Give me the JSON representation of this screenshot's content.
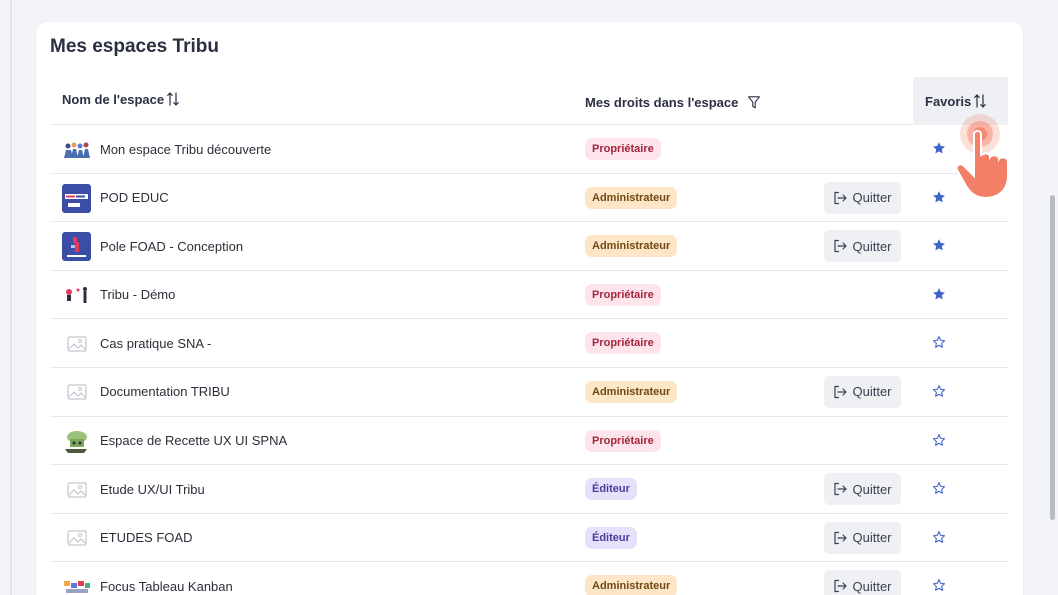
{
  "page": {
    "title": "Mes espaces Tribu"
  },
  "table": {
    "headers": {
      "name": "Nom de l'espace",
      "rights": "Mes droits dans l'espace",
      "favorites": "Favoris"
    },
    "rows": [
      {
        "name": "Mon espace Tribu découverte",
        "role": "Propriétaire",
        "role_type": "owner",
        "can_quit": false,
        "quit_label": "",
        "favorite": true,
        "thumb": "people-group"
      },
      {
        "name": "POD EDUC",
        "role": "Administrateur",
        "role_type": "admin",
        "can_quit": true,
        "quit_label": "Quitter",
        "favorite": true,
        "thumb": "pod-educ"
      },
      {
        "name": "Pole FOAD - Conception",
        "role": "Administrateur",
        "role_type": "admin",
        "can_quit": true,
        "quit_label": "Quitter",
        "favorite": true,
        "thumb": "conception"
      },
      {
        "name": "Tribu - Démo",
        "role": "Propriétaire",
        "role_type": "owner",
        "can_quit": false,
        "quit_label": "",
        "favorite": true,
        "thumb": "demo-figures"
      },
      {
        "name": "Cas pratique SNA -",
        "role": "Propriétaire",
        "role_type": "owner",
        "can_quit": false,
        "quit_label": "",
        "favorite": false,
        "thumb": "placeholder"
      },
      {
        "name": "Documentation TRIBU",
        "role": "Administrateur",
        "role_type": "admin",
        "can_quit": true,
        "quit_label": "Quitter",
        "favorite": false,
        "thumb": "placeholder"
      },
      {
        "name": "Espace de Recette UX UI SPNA",
        "role": "Propriétaire",
        "role_type": "owner",
        "can_quit": false,
        "quit_label": "",
        "favorite": false,
        "thumb": "chef-hat"
      },
      {
        "name": "Etude UX/UI Tribu",
        "role": "Éditeur",
        "role_type": "editor",
        "can_quit": true,
        "quit_label": "Quitter",
        "favorite": false,
        "thumb": "placeholder"
      },
      {
        "name": "ETUDES FOAD",
        "role": "Éditeur",
        "role_type": "editor",
        "can_quit": true,
        "quit_label": "Quitter",
        "favorite": false,
        "thumb": "placeholder"
      },
      {
        "name": "Focus Tableau Kanban",
        "role": "Administrateur",
        "role_type": "admin",
        "can_quit": true,
        "quit_label": "Quitter",
        "favorite": false,
        "thumb": "kanban"
      }
    ]
  },
  "colors": {
    "star_filled": "#3f63c7",
    "star_outline": "#3f63c7",
    "owner_badge_bg": "#fde4ea",
    "admin_badge_bg": "#fde6c8",
    "editor_badge_bg": "#e6e0fb",
    "pointer_hand": "#f47f67"
  },
  "icons": {
    "sort": "sort-arrows-icon",
    "filter": "filter-funnel-icon",
    "quit": "exit-arrow-icon",
    "favorite_on": "star-filled-icon",
    "favorite_off": "star-outline-icon",
    "pointer": "tap-hand-icon"
  }
}
